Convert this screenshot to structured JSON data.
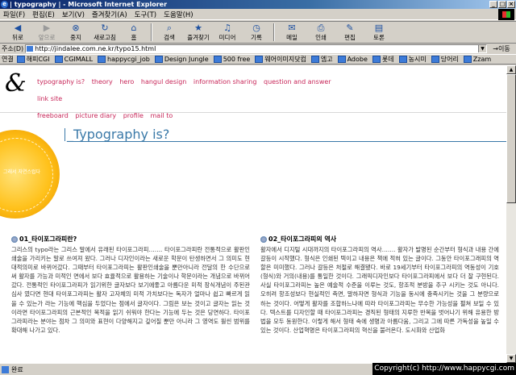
{
  "window": {
    "title": "| typography | - Microsoft Internet Explorer"
  },
  "menu": [
    "파일(F)",
    "편집(E)",
    "보기(V)",
    "즐겨찾기(A)",
    "도구(T)",
    "도움말(H)"
  ],
  "toolbar": {
    "back": "뒤로",
    "forward": "앞으로",
    "stop": "중지",
    "refresh": "새로고침",
    "home": "홈",
    "search": "검색",
    "favorites": "즐겨찾기",
    "media": "미디어",
    "history": "기록",
    "mail": "메일",
    "print": "인쇄",
    "edit": "편집",
    "discuss": "토론"
  },
  "address": {
    "label": "주소(D)",
    "url": "http://jindalee.com.ne.kr/typo15.html",
    "go": "이동"
  },
  "links": {
    "label": "연결",
    "items": [
      "해피CGI",
      "CGIMALL",
      "happycgi_job",
      "Design Jungle",
      "500 free",
      "웨어이미지닷컴",
      "엠고",
      "Adobe",
      "롯데",
      "농시미",
      "당어리",
      "Zzam"
    ]
  },
  "page": {
    "nav": [
      "typography is?",
      "theory",
      "hero",
      "hangul design",
      "information sharing",
      "question and answer",
      "link site",
      "freeboard",
      "picture diary",
      "profile",
      "mail to"
    ],
    "title": "_Typography is?",
    "orange_caption": "그래서 자연스럽다",
    "sections": [
      {
        "heading": "01_타이포그라피란?",
        "body": "그리스의 typo라는 그리스 말에서 유래된 타이포그라피……. 타이포그라피란 전통적으로 활판인쇄술을 가리키는 말로 쓰여져 왔다. 그러나 디자인이라는 새로운 학문이 탄생하면서 그 의미도 현대적의미로 바뀌어갔다. 그때부터 타이포그라피는 활판인쇄술을 뿐만아니라 전달의 한 수단으로써 활자를 가능과 미적인 면에서 보다 효율적으로 활용하는 기술이나 학문이라는 개념으로 바뀌어 갔다. 전통적인 타이포그라피가 읽기위한 글자보다 보기에좋고 아름다운 미적 장식개념이 주된관심사 였다면 현대 타이포그라피는 활자 고자체의 미적 가치보다는 독자가 얼마나 쉽고 빠르게 읽을 수 있는가 라는 기능에 핵심을 두었다는 점에서 글자이다. 그림은 보는 것이고 글자는 읽는 것이라면 타이포그라피의 근본적인 목적을 읽기 쉬워야 한다는 기능에 두는 것은 당연하다. 타이포그라피라는 분야는 점차 그 의미와 표현이 다양해지고 깊어질 뿐만 아니라 그 영역도 훨씬 범위를 확대해 나가고 있다."
      },
      {
        "heading": "02_타이포그라피의 역사",
        "body": "활자에서 디지털 시대까지의 타이포그라피의 역사……. 활자가 발명된 순간부터 형식과 내용 간에 갈등이 시작했다. 형식은 인쇄된 텍이고 내용은 책에 적혀 있는 글이다. 그동안 타이포그래피의 역할은 미미했다. 그러나 갈등은 처절로 해결됐다. 바로 19세기부터 타이포그라피의 역동성이 기호(형식)와 거의(내용)를 통일한 것이다. 그래픽디자인보다 타이포그라피에서 보다 더 잘 구현된다. 사실 타이포그라피는 높은 예술적 수준을 이루는 것도, 항조적 분방을 추구 시키는 것도 아니다. 오히려 항조성보다 현실적인 측면, 말하자면 형식과 기능을 동시에 충족시키는 것을 그 분량으로 하는 것이다. 어떻게 활자를 조합하느냐에 따라 타이포그라피는 무수한 가능성을 펼쳐 보일 수 있다. 텍스트를 디자인할 때 타이포그라피는 경직된 형태의 지루한 반복을 벗어나기 위해 유용한 방법을 모두 동원한다. 이렇게 해서 형태 속에 생명과 아름다움, 그리고 그에 따른 가독성을 높일 수 있는 것이다. 산업혁명은 타이포그라피의 혁신을 불러온다. 도시화와 산업화"
      }
    ]
  },
  "status": {
    "text": "완료",
    "copyright": "Copyright(c) http://www.happycgi.com"
  }
}
